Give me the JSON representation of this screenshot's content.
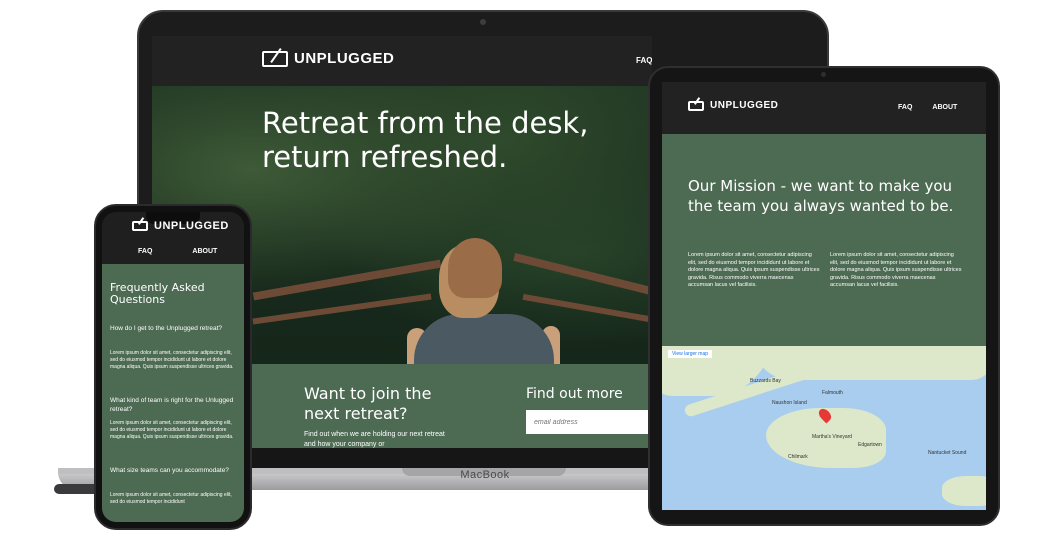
{
  "site": {
    "brand": "UNPLUGGED",
    "nav": [
      "FAQ",
      "ABOUT"
    ]
  },
  "laptop": {
    "device_label": "MacBook",
    "hero_title": "Retreat from the desk, return refreshed.",
    "cta_title": "Want to join the next retreat?",
    "cta_body": "Find out when we are holding our next retreat and how your company or",
    "find_out_title": "Find out more",
    "email_placeholder": "email address"
  },
  "phone": {
    "faq_title": "Frequently Asked Questions",
    "faq": [
      {
        "q": "How do I get to the Unplugged retreat?",
        "a": "Lorem ipsum dolor sit amet, consectetur adipiscing elit, sed do eiusmod tempor incididunt ut labore et dolore magna aliqua. Quis ipsum suspendisse ultrices gravida."
      },
      {
        "q": "What kind of team is right for the Unlugged retreat?",
        "a": "Lorem ipsum dolor sit amet, consectetur adipiscing elit, sed do eiusmod tempor incididunt ut labore et dolore magna aliqua. Quis ipsum suspendisse ultrices gravida."
      },
      {
        "q": "What size teams can you accommodate?",
        "a": "Lorem ipsum dolor sit amet, consectetur adipiscing elit, sed do eiusmod tempor incididunt"
      }
    ]
  },
  "tablet": {
    "mission_title": "Our Mission - we want to make you the team you always wanted to be.",
    "lorem": "Lorem ipsum dolor sit amet, consectetur adipiscing elit, sed do eiusmod tempor incididunt ut labore et dolore magna aliqua. Quis ipsum suspendisse ultrices gravida. Risus commodo viverra maecenas accumsan lacus vel facilisis.",
    "map": {
      "view_larger": "View larger map",
      "labels": {
        "naushon": "Naushon Island",
        "marthas": "Martha's Vineyard",
        "edgartown": "Edgartown",
        "chilmark": "Chilmark",
        "nantucket_sound": "Nantucket Sound",
        "buzzards": "Buzzards Bay",
        "falmouth": "Falmouth"
      }
    }
  },
  "colors": {
    "brand_green": "#4d6a53",
    "dark_header": "#222222"
  }
}
